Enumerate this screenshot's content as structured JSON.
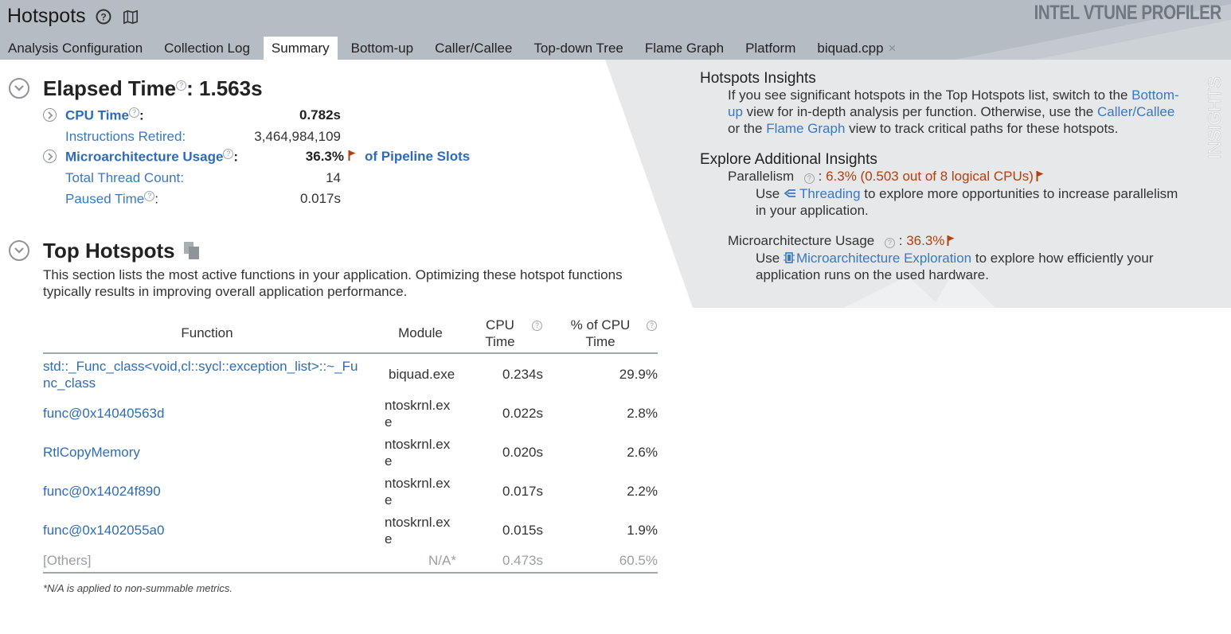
{
  "header": {
    "title": "Hotspots",
    "brand": "INTEL VTUNE PROFILER",
    "tabs": [
      "Analysis Configuration",
      "Collection Log",
      "Summary",
      "Bottom-up",
      "Caller/Callee",
      "Top-down Tree",
      "Flame Graph",
      "Platform",
      "biquad.cpp"
    ],
    "active_tab": "Summary",
    "close_glyph": "×"
  },
  "elapsed": {
    "label": "Elapsed Time",
    "value": ": 1.563s",
    "cpu_time_label": "CPU Time",
    "cpu_time_value": "0.782s",
    "instructions_label": "Instructions Retired:",
    "instructions_value": "3,464,984,109",
    "uarch_label": "Microarchitecture Usage",
    "uarch_value": "36.3%",
    "uarch_suffix": "of Pipeline Slots",
    "threads_label": "Total Thread Count:",
    "threads_value": "14",
    "paused_label": "Paused Time",
    "paused_value": "0.017s"
  },
  "top_hotspots": {
    "title": "Top Hotspots",
    "description_1": "This section lists the most active functions in your application. Optimizing these hotspot functions",
    "description_2": "typically results in improving overall application performance.",
    "columns": {
      "function": "Function",
      "module": "Module",
      "cpu_time_1": "CPU",
      "cpu_time_2": "Time",
      "pct_1": "% of CPU",
      "pct_2": "Time"
    },
    "rows": [
      {
        "function_1": "std::_Func_class<void,cl::sycl::exception_list>::~_Fu",
        "function_2": "nc_class",
        "module_1": "biquad.exe",
        "module_2": "",
        "cpu": "0.234s",
        "pct": "29.9%"
      },
      {
        "function_1": "func@0x14040563d",
        "function_2": "",
        "module_1": "ntoskrnl.ex",
        "module_2": "e",
        "cpu": "0.022s",
        "pct": "2.8%"
      },
      {
        "function_1": "RtlCopyMemory",
        "function_2": "",
        "module_1": "ntoskrnl.ex",
        "module_2": "e",
        "cpu": "0.020s",
        "pct": "2.6%"
      },
      {
        "function_1": "func@0x14024f890",
        "function_2": "",
        "module_1": "ntoskrnl.ex",
        "module_2": "e",
        "cpu": "0.017s",
        "pct": "2.2%"
      },
      {
        "function_1": "func@0x1402055a0",
        "function_2": "",
        "module_1": "ntoskrnl.ex",
        "module_2": "e",
        "cpu": "0.015s",
        "pct": "1.9%"
      }
    ],
    "others": {
      "function": "[Others]",
      "module": "N/A*",
      "cpu": "0.473s",
      "pct": "60.5%"
    },
    "note": "*N/A is applied to non-summable metrics."
  },
  "insights": {
    "vertical_label": "INSIGHTS",
    "hotspots_title": "Hotspots Insights",
    "hs_1a": "If you see significant hotspots in the Top Hotspots list, switch to the ",
    "hs_1b": "Bottom-",
    "hs_2a": "up",
    "hs_2b": " view for in-depth analysis per function. Otherwise, use the ",
    "hs_2c": "Caller/Callee",
    "hs_3a": "or the ",
    "hs_3b": "Flame Graph",
    "hs_3c": " view to track critical paths for these hotspots.",
    "explore_title": "Explore Additional Insights",
    "parallelism_label": "Parallelism",
    "parallelism_colon": ":",
    "parallelism_value": "6.3% (0.503 out of 8 logical CPUs)",
    "par_use": "Use ",
    "par_link": "Threading",
    "par_rest": " to explore more opportunities to increase parallelism",
    "par_line2": "in your application.",
    "uarch_label": "Microarchitecture Usage",
    "uarch_colon": ":",
    "uarch_value": "36.3%",
    "ua_use": "Use ",
    "ua_link": "Microarchitecture Exploration",
    "ua_rest": " to explore how efficiently your",
    "ua_line2": "application runs on the used hardware."
  },
  "colors": {
    "header_bg": "#b5bcc4",
    "insight_bg": "#e6e8ea",
    "link": "#3b78c0",
    "warning": "#b3400e"
  }
}
